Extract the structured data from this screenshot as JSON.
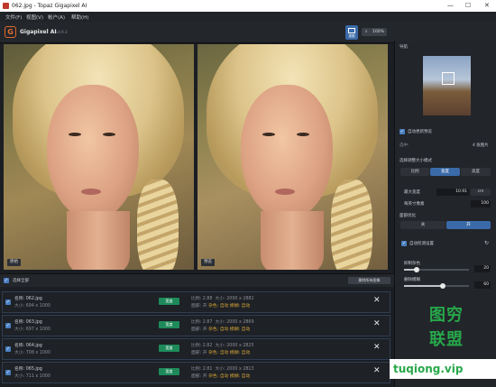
{
  "window": {
    "title": "062.jpg - Topaz Gigapixel AI",
    "minimize": "—",
    "maximize": "☐",
    "close": "✕"
  },
  "menu": [
    "文件(F)",
    "视图(V)",
    "帐户(A)",
    "帮助(H)"
  ],
  "header": {
    "app_name": "Gigapixel AI",
    "version": "v4.9.3",
    "view_label": "视图",
    "zoom_label": "100%"
  },
  "panels": {
    "left_tag": "原始",
    "right_tag": "预览"
  },
  "sidebar": {
    "nav_title": "导航",
    "auto_update_preview": "自动更新预览",
    "selected_label": "选中:",
    "selected_value": "4 张图片",
    "resize_mode_label": "选择调整大小模式",
    "resize_modes": [
      "比例",
      "宽度",
      "高度"
    ],
    "resize_mode_selected": "宽度",
    "max_width_label": "最大宽度",
    "max_width_value": "10.91",
    "max_width_unit": "cm",
    "dpi_label": "每英寸像素",
    "dpi_value": "100",
    "face_refine_label": "面部优化",
    "face_refine_options": [
      "关",
      "开"
    ],
    "face_refine_selected": "开",
    "auto_detect_label": "自动检测设置",
    "suppress_noise_label": "抑制杂色",
    "suppress_noise_value": "20",
    "suppress_noise_level": 0.2,
    "remove_blur_label": "删除模糊",
    "remove_blur_value": "60",
    "remove_blur_level": 0.6
  },
  "queue": {
    "select_all": "选择全部",
    "remove_all": "删除所有图像",
    "rows": [
      {
        "name": "名称: 062.jpg",
        "size": "大小: 694 x 1000",
        "tag": "宽度",
        "ratio": "比例: 2.88",
        "out_size": "大小: 2000 x 2882",
        "noise": "面部: 开",
        "extra": "杂色: 自动 模糊: 自动"
      },
      {
        "name": "名称: 063.jpg",
        "size": "大小: 697 x 1000",
        "tag": "宽度",
        "ratio": "比例: 2.87",
        "out_size": "大小: 2000 x 2869",
        "noise": "面部: 开",
        "extra": "杂色: 自动 模糊: 自动"
      },
      {
        "name": "名称: 064.jpg",
        "size": "大小: 708 x 1000",
        "tag": "宽度",
        "ratio": "比例: 2.82",
        "out_size": "大小: 2000 x 2825",
        "noise": "面部: 开",
        "extra": "杂色: 自动 模糊: 自动"
      },
      {
        "name": "名称: 065.jpg",
        "size": "大小: 711 x 1000",
        "tag": "宽度",
        "ratio": "比例: 2.81",
        "out_size": "大小: 2000 x 2813",
        "noise": "面部: 开",
        "extra": "杂色: 自动 模糊: 自动"
      }
    ]
  },
  "watermark": {
    "line1": "图穷",
    "line2": "联盟",
    "url": "tuqiong.vip"
  },
  "colors": {
    "accent": "#3a6aa8",
    "tag_green": "#1e8a5a",
    "watermark_green": "#27a84a"
  }
}
